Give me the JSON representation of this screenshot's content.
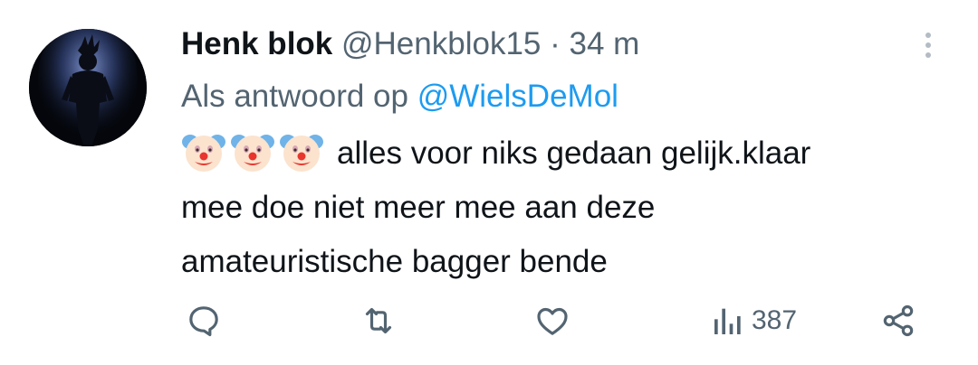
{
  "tweet": {
    "author_name": "Henk blok",
    "handle": "@Henkblok15",
    "separator": "·",
    "time": "34 m",
    "reply_prefix": "Als antwoord op",
    "reply_mention": "@WielsDeMol",
    "emojis": [
      "clown-face",
      "clown-face",
      "clown-face"
    ],
    "text_line1": "alles voor niks gedaan gelijk.klaar",
    "text_line2": "mee doe niet meer mee aan deze",
    "text_line3": "amateuristische bagger bende"
  },
  "actions": {
    "views_count": "387"
  },
  "colors": {
    "secondary_text": "#536471",
    "link": "#1d9bf0",
    "primary_text": "#0f1419"
  }
}
